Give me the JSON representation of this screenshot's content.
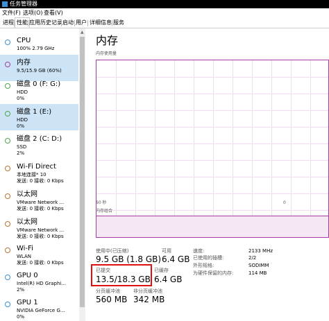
{
  "window": {
    "title": "任务管理器"
  },
  "menu": [
    "文件(F)",
    "选项(O)",
    "查看(V)"
  ],
  "tabs": [
    {
      "label": "进程",
      "active": false
    },
    {
      "label": "性能",
      "active": true
    },
    {
      "label": "应用历史记录",
      "active": false
    },
    {
      "label": "启动",
      "active": false
    },
    {
      "label": "用户",
      "active": false
    },
    {
      "label": "详细信息",
      "active": false
    },
    {
      "label": "服务",
      "active": false
    }
  ],
  "sidebar": {
    "items": [
      {
        "name": "CPU",
        "line2": "100%  2.79 GHz",
        "line3": "",
        "color": "#3a8fd8"
      },
      {
        "name": "内存",
        "line2": "9.5/15.9 GB (60%)",
        "line3": "",
        "color": "#a33da3",
        "selected": true
      },
      {
        "name": "磁盘 0 (F: G:)",
        "line2": "HDD",
        "line3": "0%",
        "color": "#4da34d"
      },
      {
        "name": "磁盘 1 (E:)",
        "line2": "HDD",
        "line3": "0%",
        "color": "#4da34d"
      },
      {
        "name": "磁盘 2 (C: D:)",
        "line2": "SSD",
        "line3": "2%",
        "color": "#4da34d"
      },
      {
        "name": "Wi-Fi Direct",
        "line2": "本地连接* 10",
        "line3": "发送: 0 接收: 0 Kbps",
        "color": "#b87333"
      },
      {
        "name": "以太网",
        "line2": "VMware Network ...",
        "line3": "发送: 0 接收: 0 Kbps",
        "color": "#b87333"
      },
      {
        "name": "以太网",
        "line2": "VMware Network ...",
        "line3": "发送: 0 接收: 0 Kbps",
        "color": "#b87333"
      },
      {
        "name": "Wi-Fi",
        "line2": "WLAN",
        "line3": "发送: 0 接收: 0 Kbps",
        "color": "#b87333"
      },
      {
        "name": "GPU 0",
        "line2": "Intel(R) HD Graphi...",
        "line3": "2%",
        "color": "#3a8fd8"
      },
      {
        "name": "GPU 1",
        "line2": "NVIDIA GeForce G...",
        "line3": "0%",
        "color": "#3a8fd8"
      }
    ]
  },
  "main": {
    "title": "内存",
    "usage_label": "内存使用量",
    "time_label": "60 秒",
    "zero_label": "0",
    "composition_label": "内存组合",
    "stats": {
      "in_use_label": "使用中(已压缩)",
      "in_use_value": "9.5 GB (1.8 GB)",
      "available_label": "可用",
      "available_value": "6.4 GB",
      "committed_label": "已提交",
      "committed_value": "13.5/18.3 GB",
      "cached_label": "已缓存",
      "cached_value": "6.4 GB",
      "paged_label": "分页缓冲池",
      "paged_value": "560 MB",
      "nonpaged_label": "非分页缓冲池",
      "nonpaged_value": "342 MB"
    },
    "right": [
      {
        "k": "速度:",
        "v": "2133 MHz"
      },
      {
        "k": "已使用的插槽:",
        "v": "2/2"
      },
      {
        "k": "外形规格:",
        "v": "SODIMM"
      },
      {
        "k": "为硬件保留的内存:",
        "v": "114 MB"
      }
    ]
  },
  "highlight": {
    "color": "#e01010"
  }
}
